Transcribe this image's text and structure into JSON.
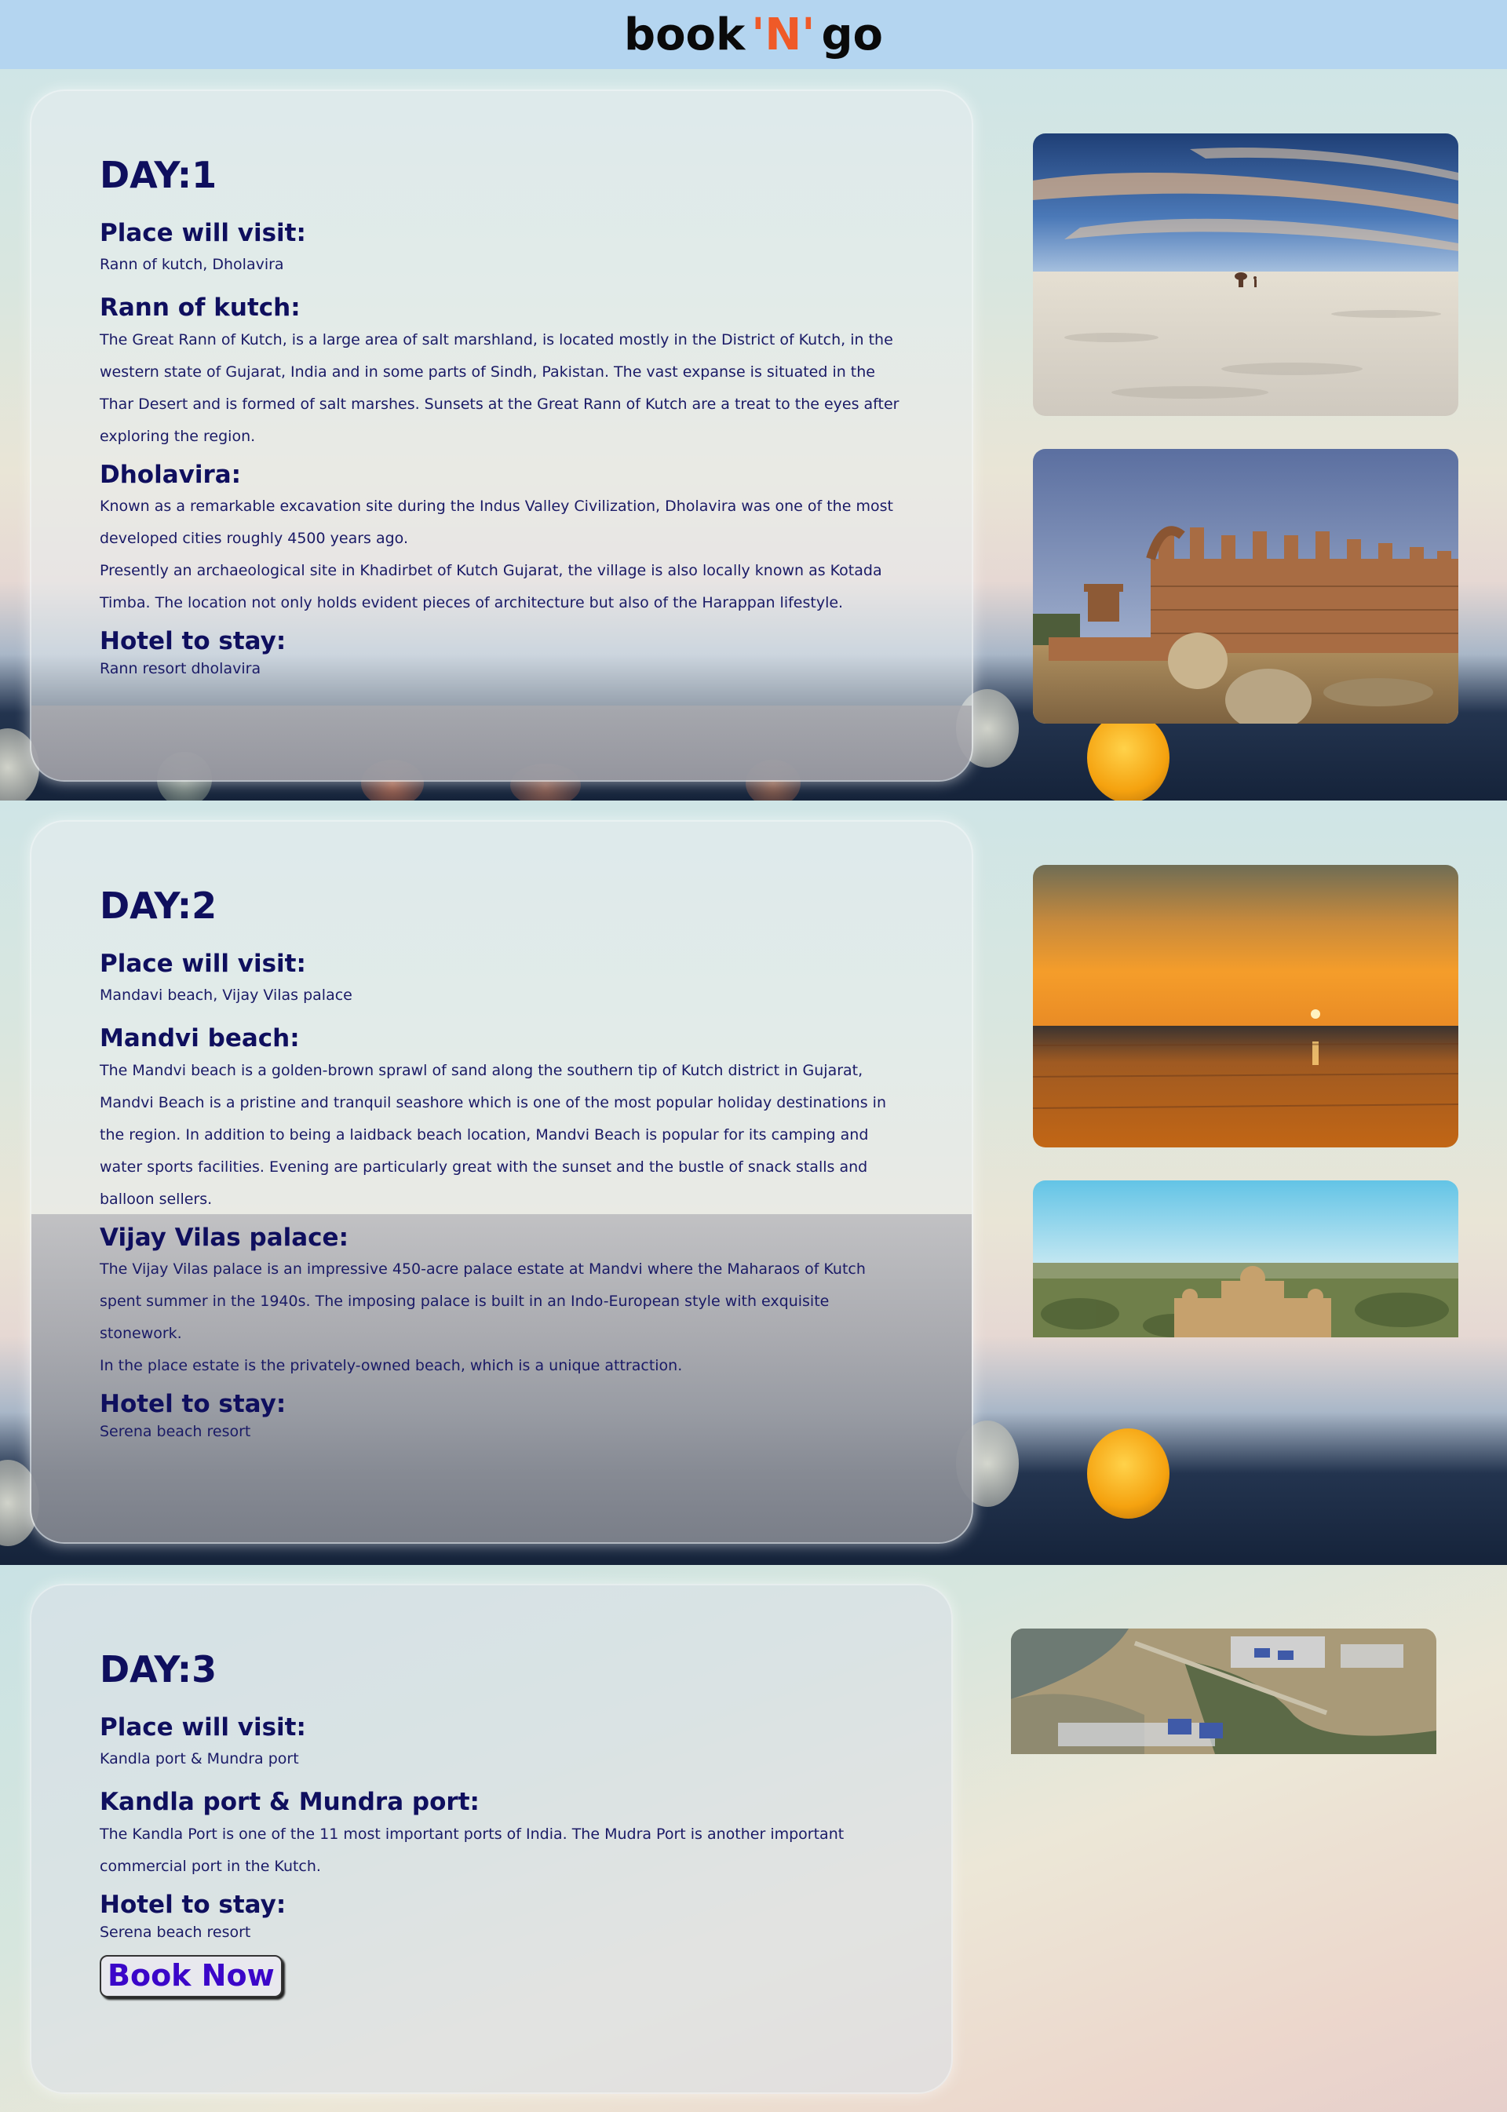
{
  "brand": {
    "part1": "book",
    "part2": "'N'",
    "part3": "go",
    "accent_color": "#ef5a28"
  },
  "days": [
    {
      "title": "DAY:1",
      "visit_label": "Place will visit:",
      "visit_value": "Rann of kutch, Dholavira",
      "sections": [
        {
          "heading": "Rann of kutch:",
          "paragraphs": [
            "The Great Rann of Kutch, is a large area of salt marshland, is located mostly in the District of Kutch, in the western state of Gujarat, India and in some parts of Sindh, Pakistan. The vast expanse is situated in the Thar Desert and is formed of salt marshes. Sunsets at the Great Rann of Kutch are a treat to the eyes after exploring the region."
          ]
        },
        {
          "heading": "Dholavira:",
          "paragraphs": [
            "Known as a remarkable excavation site during the Indus Valley Civilization, Dholavira was one of the most developed cities roughly 4500 years ago.",
            "Presently an archaeological site in Khadirbet of Kutch Gujarat, the village is also locally known as Kotada Timba. The location not only holds evident pieces of architecture but also of the Harappan lifestyle."
          ]
        }
      ],
      "hotel_label": "Hotel to stay:",
      "hotel_value": "Rann resort dholavira",
      "photos": [
        "white-salt-desert-photo",
        "dholavira-ruins-photo"
      ]
    },
    {
      "title": "DAY:2",
      "visit_label": "Place will visit:",
      "visit_value": "Mandavi beach, Vijay Vilas palace",
      "sections": [
        {
          "heading": "Mandvi beach:",
          "paragraphs": [
            "The Mandvi beach is a golden-brown sprawl of sand along the southern tip of Kutch district in Gujarat, Mandvi Beach is a pristine and tranquil seashore which is one of the most popular holiday destinations in the region. In addition to being a laidback beach location, Mandvi Beach is popular for its camping and water sports facilities. Evening are particularly great with the sunset and the bustle of snack stalls and balloon sellers."
          ]
        },
        {
          "heading": "Vijay Vilas palace:",
          "paragraphs": [
            "The Vijay Vilas palace is an impressive 450-acre palace estate at Mandvi where the Maharaos of Kutch spent summer in the 1940s. The imposing palace is built in an Indo-European style with exquisite stonework.",
            "In the place estate is the privately-owned beach, which is a unique attraction."
          ]
        }
      ],
      "hotel_label": "Hotel to stay:",
      "hotel_value": "Serena beach resort",
      "photos": [
        "mandvi-sunset-photo",
        "vijay-vilas-palace-photo"
      ]
    },
    {
      "title": "DAY:3",
      "visit_label": "Place will visit:",
      "visit_value": "Kandla port & Mundra port",
      "sections": [
        {
          "heading": "Kandla port & Mundra port:",
          "paragraphs": [
            "The Kandla Port is one of the 11 most important ports of India. The Mudra Port is another important commercial port in the Kutch."
          ]
        }
      ],
      "hotel_label": "Hotel to stay:",
      "hotel_value": "Serena beach resort",
      "photos": [
        "port-aerial-photo"
      ]
    }
  ],
  "book_button": "Book Now"
}
